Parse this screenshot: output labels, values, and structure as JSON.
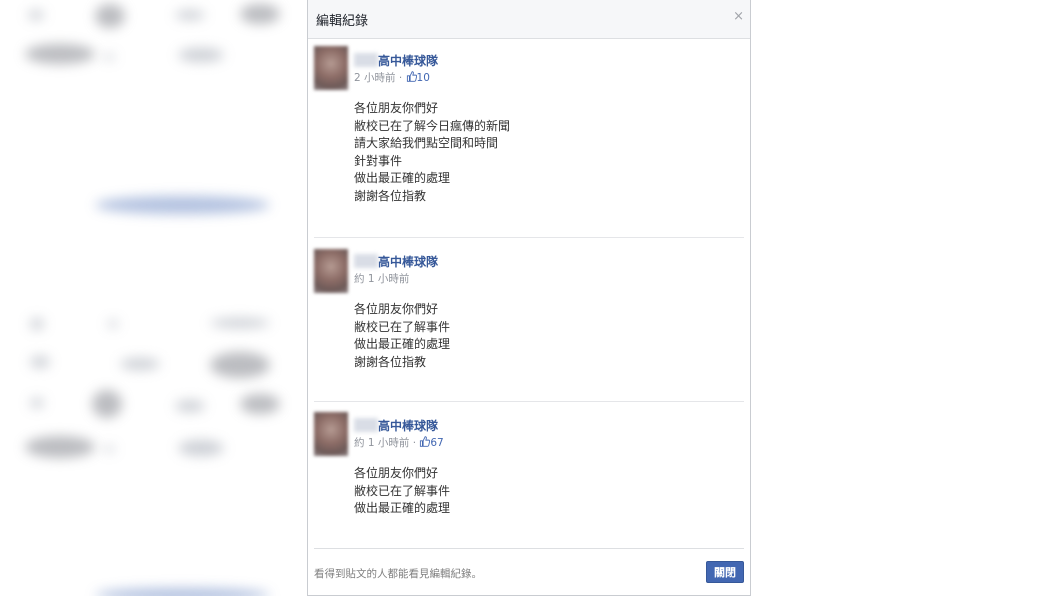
{
  "dialog": {
    "title": "編輯紀錄",
    "close_icon": "×",
    "footer_note": "看得到貼文的人都能看見編輯紀錄。",
    "close_button": "關閉"
  },
  "entries": [
    {
      "author": "高中棒球隊",
      "time": "2 小時前",
      "dot": " · ",
      "thumb_icon": "thumbs-up",
      "likes": "10",
      "lines": [
        "各位朋友你們好",
        "敝校已在了解今日瘋傳的新聞",
        "請大家給我們點空間和時間",
        "針對事件",
        "做出最正確的處理",
        "謝謝各位指教"
      ]
    },
    {
      "author": "高中棒球隊",
      "time": "約 1 小時前",
      "lines": [
        "各位朋友你們好",
        "敝校已在了解事件",
        "做出最正確的處理",
        "謝謝各位指教"
      ]
    },
    {
      "author": "高中棒球隊",
      "time": "約 1 小時前",
      "dot": " · ",
      "thumb_icon": "thumbs-up",
      "likes": "67",
      "lines": [
        "各位朋友你們好",
        "敝校已在了解事件",
        "做出最正確的處理"
      ]
    }
  ],
  "colors": {
    "accent": "#4267b2",
    "link": "#365899"
  }
}
